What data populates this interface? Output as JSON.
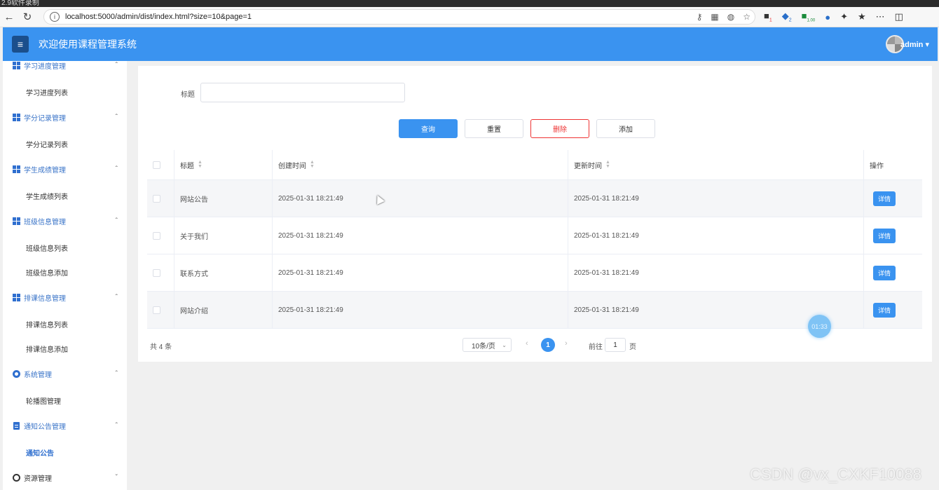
{
  "chrome": {
    "top_text": "2.9软件录制",
    "url": "localhost:5000/admin/dist/index.html?size=10&page=1",
    "ext_badges": [
      "1",
      "2",
      "1.00"
    ]
  },
  "header": {
    "title": "欢迎使用课程管理系统",
    "user": "admin",
    "accent_color": "#3a93f0"
  },
  "sidebar": {
    "groups": [
      {
        "label": "学习进度管理",
        "icon": "grid-icon"
      },
      {
        "label": "学分记录管理",
        "icon": "grid-icon"
      },
      {
        "label": "学生成绩管理",
        "icon": "grid-icon"
      },
      {
        "label": "班级信息管理",
        "icon": "grid-icon"
      },
      {
        "label": "排课信息管理",
        "icon": "grid-icon"
      },
      {
        "label": "系统管理",
        "icon": "gear-icon"
      },
      {
        "label": "通知公告管理",
        "icon": "document-icon"
      },
      {
        "label": "资源管理",
        "icon": "circle-icon"
      }
    ],
    "items": [
      "学习进度列表",
      "学分记录列表",
      "学生成绩列表",
      "班级信息列表",
      "班级信息添加",
      "排课信息列表",
      "排课信息添加",
      "轮播图管理",
      "通知公告"
    ]
  },
  "filter": {
    "label": "标题",
    "value": ""
  },
  "buttons": {
    "query": "查询",
    "reset": "重置",
    "delete": "删除",
    "add": "添加"
  },
  "table": {
    "columns": [
      "标题",
      "创建时间",
      "更新时间",
      "操作"
    ],
    "rows": [
      {
        "title": "网站公告",
        "created": "2025-01-31 18:21:49",
        "updated": "2025-01-31 18:21:49",
        "action": "详情"
      },
      {
        "title": "关于我们",
        "created": "2025-01-31 18:21:49",
        "updated": "2025-01-31 18:21:49",
        "action": "详情"
      },
      {
        "title": "联系方式",
        "created": "2025-01-31 18:21:49",
        "updated": "2025-01-31 18:21:49",
        "action": "详情"
      },
      {
        "title": "网站介绍",
        "created": "2025-01-31 18:21:49",
        "updated": "2025-01-31 18:21:49",
        "action": "详情"
      }
    ]
  },
  "pagination": {
    "total": "共 4 条",
    "page_size": "10条/页",
    "current_page": "1",
    "goto_label": "前往",
    "goto_value": "1",
    "goto_unit": "页"
  },
  "overlay": {
    "timer": "01:33",
    "watermark": "CSDN @vx_CXKF10088"
  }
}
